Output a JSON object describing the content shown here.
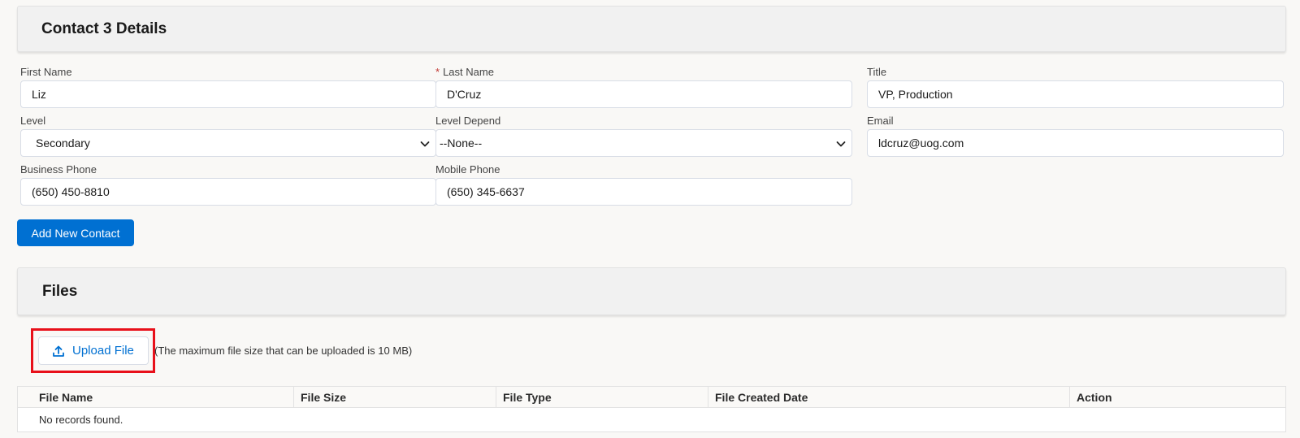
{
  "contact_section": {
    "title": "Contact 3 Details",
    "fields": {
      "first_name": {
        "label": "First Name",
        "value": "Liz"
      },
      "last_name": {
        "label": "Last Name",
        "required_mark": "*",
        "value": "D'Cruz"
      },
      "title": {
        "label": "Title",
        "value": "VP, Production"
      },
      "level": {
        "label": "Level",
        "value": "Secondary"
      },
      "level_depend": {
        "label": "Level Depend",
        "value": "--None--"
      },
      "email": {
        "label": "Email",
        "value": "ldcruz@uog.com"
      },
      "business_phone": {
        "label": "Business Phone",
        "value": "(650) 450-8810"
      },
      "mobile_phone": {
        "label": "Mobile Phone",
        "value": "(650) 345-6637"
      }
    },
    "add_button": "Add New Contact"
  },
  "files_section": {
    "title": "Files",
    "upload_button": "Upload File",
    "upload_note": "(The maximum file size that can be uploaded is 10 MB)",
    "table": {
      "columns": [
        "File Name",
        "File Size",
        "File Type",
        "File Created Date",
        "Action"
      ],
      "empty_text": "No records found."
    }
  },
  "colors": {
    "primary": "#0070d2",
    "highlight": "#e8101a",
    "required": "#c23934"
  },
  "icons": {
    "upload": "upload-icon",
    "dropdown": "chevron-down-icon"
  }
}
